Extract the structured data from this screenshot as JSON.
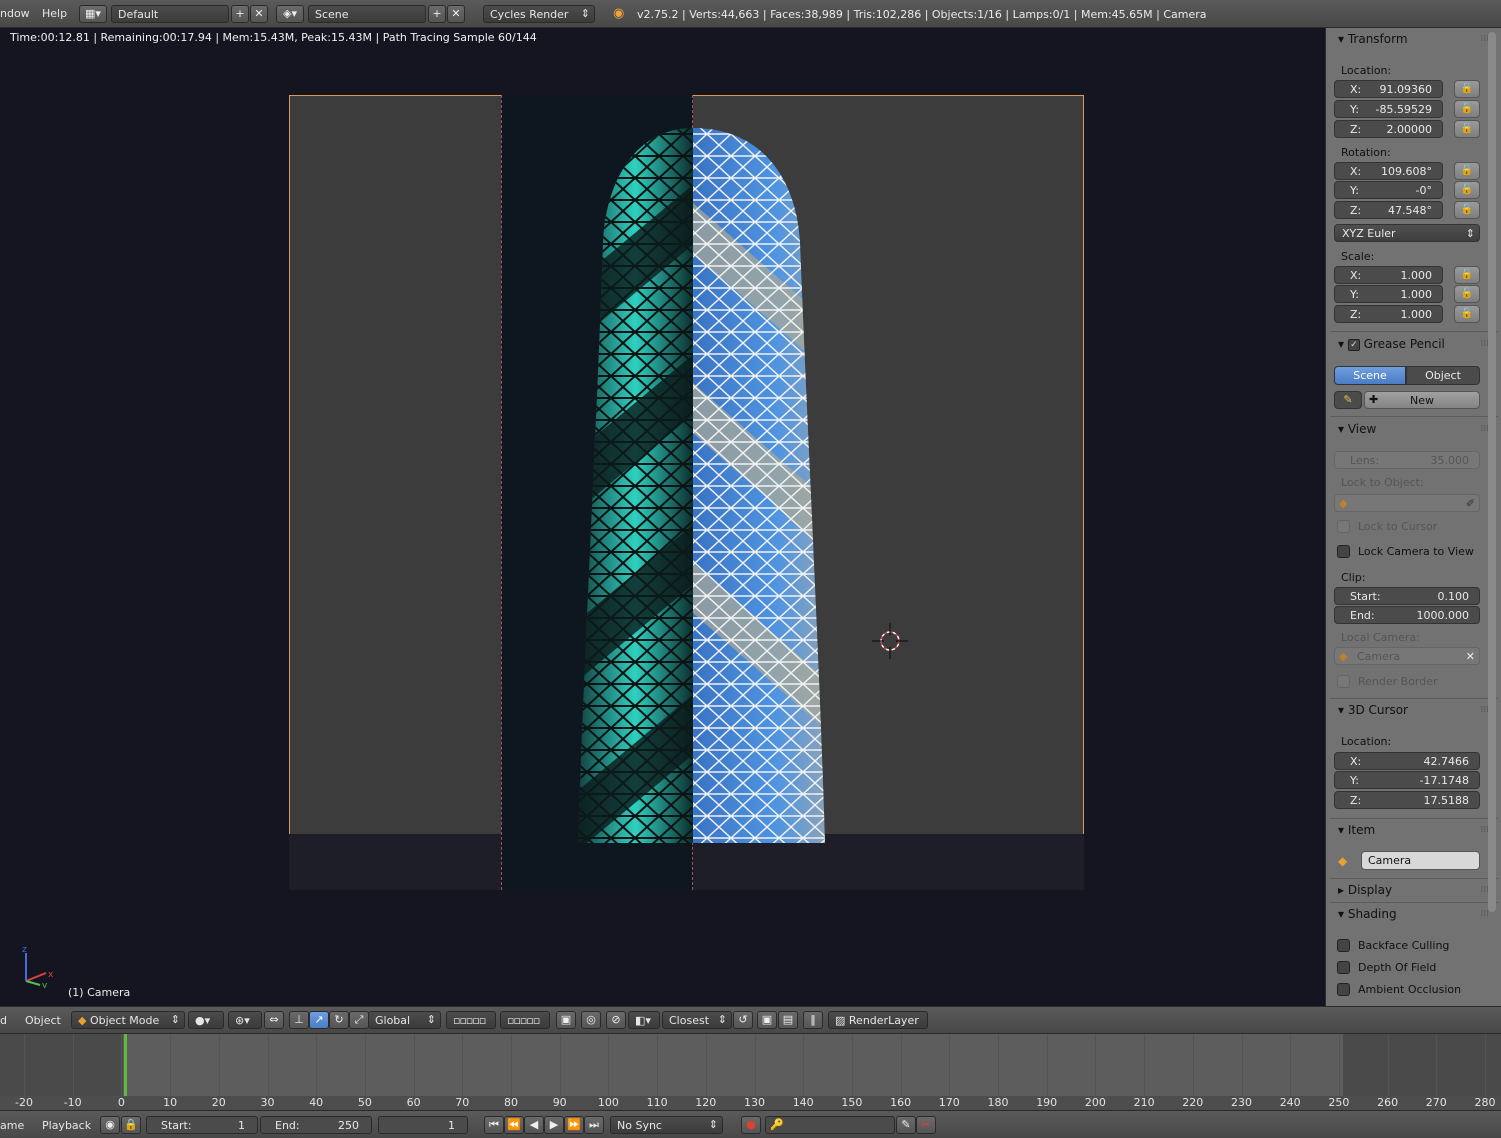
{
  "topbar": {
    "menu_window": "ndow",
    "menu_help": "Help",
    "layout_name": "Default",
    "scene_name": "Scene",
    "render_engine": "Cycles Render",
    "stats": "v2.75.2 | Verts:44,663 | Faces:38,989 | Tris:102,286 | Objects:1/16 | Lamps:0/1 | Mem:45.65M | Camera"
  },
  "viewport": {
    "render_status": "Time:00:12.81 | Remaining:00:17.94 | Mem:15.43M, Peak:15.43M | Path Tracing Sample 60/144",
    "object_label": "(1) Camera",
    "axis_x": "x",
    "axis_y": "y",
    "axis_z": "z"
  },
  "panel": {
    "transform": {
      "title": "Transform",
      "location_label": "Location:",
      "location": [
        {
          "axis": "X:",
          "value": "91.09360"
        },
        {
          "axis": "Y:",
          "value": "-85.59529"
        },
        {
          "axis": "Z:",
          "value": "2.00000"
        }
      ],
      "rotation_label": "Rotation:",
      "rotation": [
        {
          "axis": "X:",
          "value": "109.608°"
        },
        {
          "axis": "Y:",
          "value": "-0°"
        },
        {
          "axis": "Z:",
          "value": "47.548°"
        }
      ],
      "rotation_mode": "XYZ Euler",
      "scale_label": "Scale:",
      "scale": [
        {
          "axis": "X:",
          "value": "1.000"
        },
        {
          "axis": "Y:",
          "value": "1.000"
        },
        {
          "axis": "Z:",
          "value": "1.000"
        }
      ]
    },
    "grease_pencil": {
      "title": "Grease Pencil",
      "tab_scene": "Scene",
      "tab_object": "Object",
      "new_label": "New"
    },
    "view": {
      "title": "View",
      "lens_label": "Lens:",
      "lens_value": "35.000",
      "lock_object_label": "Lock to Object:",
      "lock_cursor": "Lock to Cursor",
      "lock_camera": "Lock Camera to View",
      "clip_label": "Clip:",
      "clip_start_label": "Start:",
      "clip_start": "0.100",
      "clip_end_label": "End:",
      "clip_end": "1000.000",
      "local_camera_label": "Local Camera:",
      "local_camera": "Camera",
      "render_border": "Render Border"
    },
    "cursor": {
      "title": "3D Cursor",
      "location_label": "Location:",
      "location": [
        {
          "axis": "X:",
          "value": "42.7466"
        },
        {
          "axis": "Y:",
          "value": "-17.1748"
        },
        {
          "axis": "Z:",
          "value": "17.5188"
        }
      ]
    },
    "item": {
      "title": "Item",
      "name": "Camera"
    },
    "display": {
      "title": "Display"
    },
    "shading": {
      "title": "Shading",
      "backface": "Backface Culling",
      "dof": "Depth Of Field",
      "ao": "Ambient Occlusion"
    }
  },
  "view_header": {
    "menu_view_partial": "d",
    "menu_object": "Object",
    "mode": "Object Mode",
    "orientation": "Global",
    "snap": "Closest",
    "render_layer": "RenderLayer"
  },
  "timeline": {
    "ticks": [
      "-20",
      "-10",
      "0",
      "10",
      "20",
      "30",
      "40",
      "50",
      "60",
      "70",
      "80",
      "90",
      "100",
      "110",
      "120",
      "130",
      "140",
      "150",
      "160",
      "170",
      "180",
      "190",
      "200",
      "210",
      "220",
      "230",
      "240",
      "250",
      "260",
      "270",
      "280"
    ],
    "current_frame": 1
  },
  "bottombar": {
    "menu_frame_partial": "ame",
    "menu_playback": "Playback",
    "start_label": "Start:",
    "start_value": "1",
    "end_label": "End:",
    "end_value": "250",
    "current_value": "1",
    "sync": "No Sync"
  },
  "colors": {
    "camera_frame": "#d89b55",
    "active_tab": "#5b8ad4",
    "timeline_cursor": "#5fba3c",
    "glass_blue": "#4a8ad8",
    "glass_teal": "#2fd0c0"
  }
}
